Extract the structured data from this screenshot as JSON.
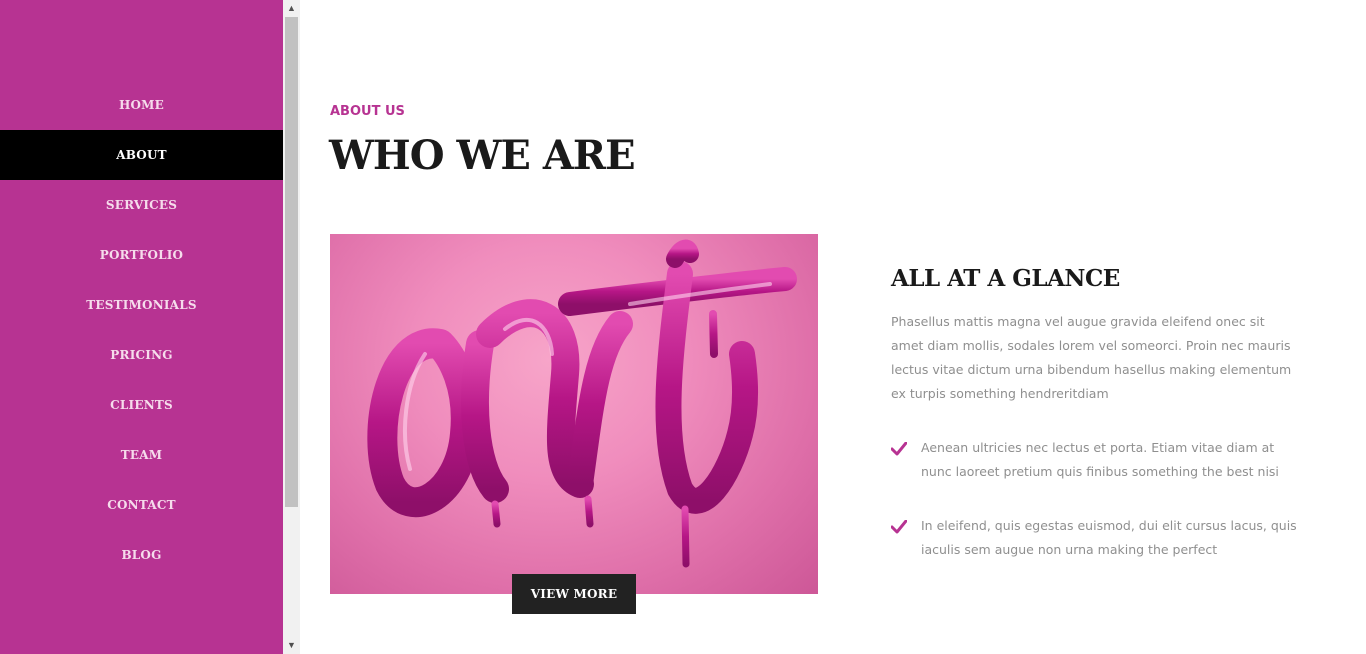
{
  "theme": {
    "accent": "#b73392",
    "active_nav_bg": "#000000",
    "dark_button": "#222222"
  },
  "nav": {
    "items": [
      {
        "label": "HOME",
        "active": false
      },
      {
        "label": "ABOUT",
        "active": true
      },
      {
        "label": "SERVICES",
        "active": false
      },
      {
        "label": "PORTFOLIO",
        "active": false
      },
      {
        "label": "TESTIMONIALS",
        "active": false
      },
      {
        "label": "PRICING",
        "active": false
      },
      {
        "label": "CLIENTS",
        "active": false
      },
      {
        "label": "TEAM",
        "active": false
      },
      {
        "label": "CONTACT",
        "active": false
      },
      {
        "label": "BLOG",
        "active": false
      }
    ]
  },
  "about": {
    "label": "ABOUT US",
    "title": "WHO WE ARE",
    "image_icon": "art-image",
    "view_more_label": "VIEW MORE",
    "glance_title": "ALL AT A GLANCE",
    "glance_text": "Phasellus mattis magna vel augue gravida eleifend onec sit amet diam mollis, sodales lorem vel someorci. Proin nec mauris lectus vitae dictum urna bibendum hasellus making elementum ex turpis something hendreritdiam",
    "features": [
      {
        "icon": "check-icon",
        "text": "Aenean ultricies nec lectus et porta. Etiam vitae diam at nunc laoreet pretium quis finibus something the best nisi"
      },
      {
        "icon": "check-icon",
        "text": "In eleifend, quis egestas euismod, dui elit cursus lacus, quis iaculis sem augue non urna making the perfect"
      }
    ]
  },
  "scrollbar": {
    "up_icon": "chevron-up-icon",
    "down_icon": "chevron-down-icon"
  }
}
